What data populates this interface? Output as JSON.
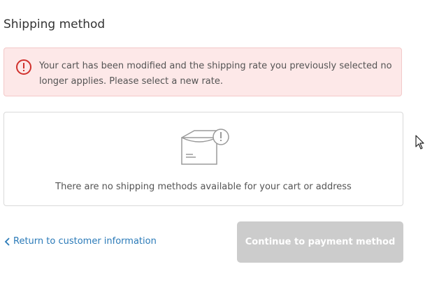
{
  "section": {
    "title": "Shipping method"
  },
  "alert": {
    "icon": "alert-circle-icon",
    "message": "Your cart has been modified and the shipping rate you previously selected no longer applies. Please select a new rate.",
    "color": "#d0312d",
    "background": "#fde8e8"
  },
  "empty_state": {
    "icon": "package-alert-icon",
    "message": "There are no shipping methods available for your cart or address"
  },
  "footer": {
    "return_link_label": "Return to customer information",
    "return_link_icon": "chevron-left-icon",
    "continue_button_label": "Continue to payment method",
    "continue_button_disabled": true,
    "link_color": "#2a7ab8",
    "button_color": "#cccccc"
  },
  "cursor_icon": "mouse-pointer-icon"
}
